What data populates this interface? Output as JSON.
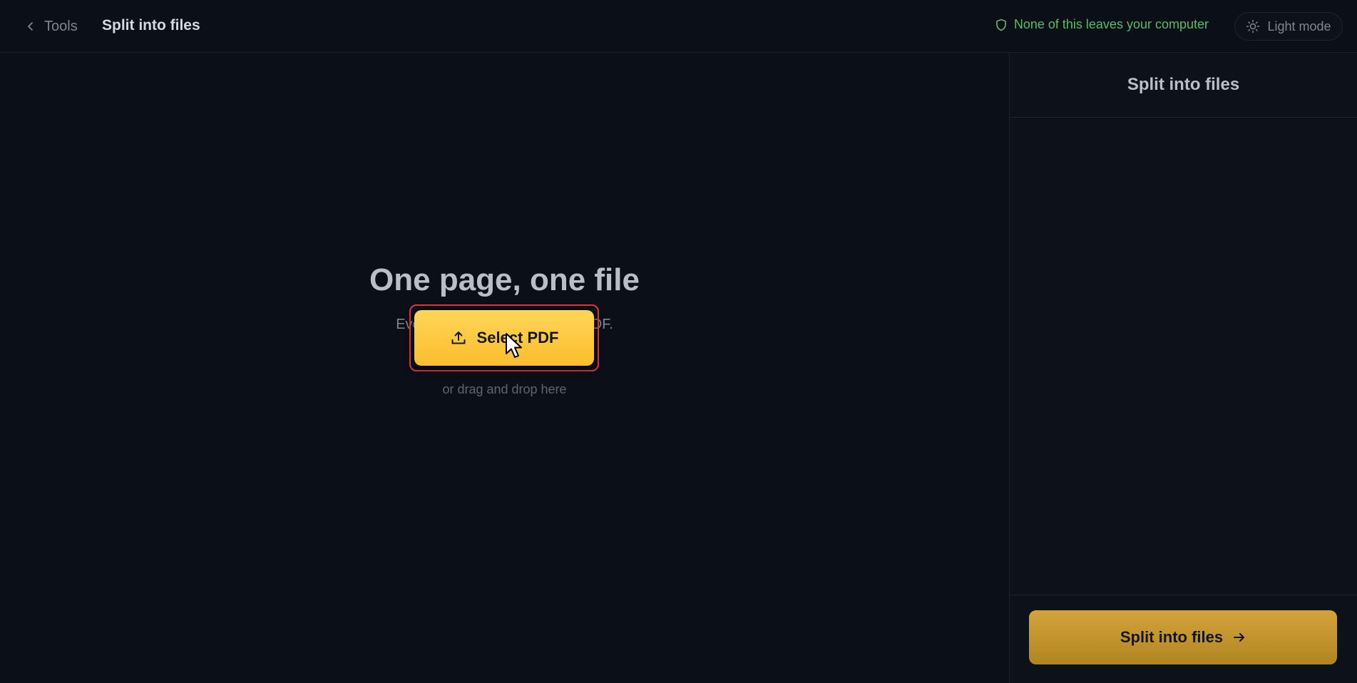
{
  "header": {
    "back_label": "Tools",
    "title": "Split into files",
    "privacy_text": "None of this leaves your computer",
    "theme_label": "Light mode"
  },
  "main": {
    "title": "One page, one file",
    "subtitle": "Every page becomes its own PDF.",
    "select_label": "Select PDF",
    "drop_hint": "or drag and drop here"
  },
  "sidebar": {
    "title": "Split into files",
    "action_label": "Split into files"
  },
  "colors": {
    "background": "#0b0f17",
    "accent": "#fbbd2c",
    "privacy": "#5cb96a",
    "highlight": "#e5343f"
  },
  "icons": [
    "chevron-left-icon",
    "shield-icon",
    "sun-icon",
    "upload-icon",
    "arrow-right-icon",
    "mouse-cursor-icon"
  ]
}
